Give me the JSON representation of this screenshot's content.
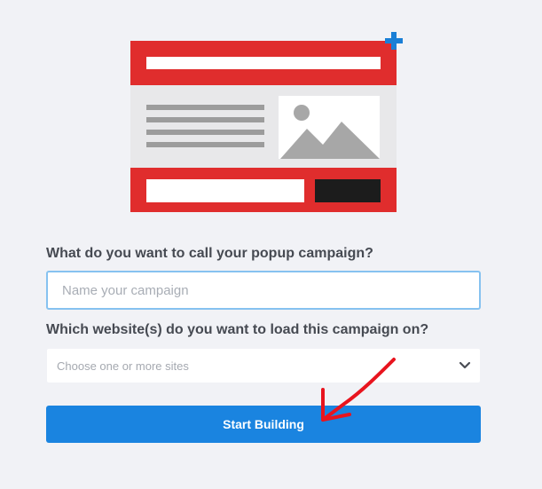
{
  "form": {
    "name_question": "What do you want to call your popup campaign?",
    "name_placeholder": "Name your campaign",
    "name_value": "",
    "sites_question": "Which website(s) do you want to load this campaign on?",
    "sites_placeholder": "Choose one or more sites",
    "submit_label": "Start Building"
  },
  "icons": {
    "popup_illustration": "popup-template-illustration",
    "plus": "plus-icon",
    "dropdown": "chevron-down-icon",
    "annotation": "red-arrow-annotation"
  },
  "colors": {
    "background": "#f1f2f6",
    "popup_red": "#e02d2d",
    "accent_blue": "#1a84e0",
    "input_border": "#86c2f0",
    "label_text": "#464a52",
    "annotation_red": "#e8141e"
  }
}
